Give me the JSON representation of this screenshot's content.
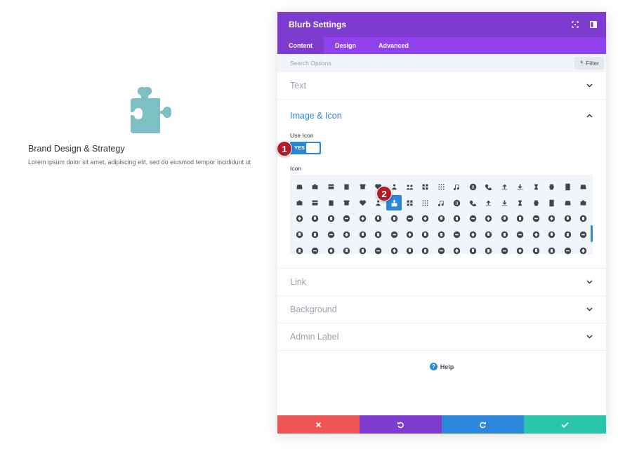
{
  "preview": {
    "icon": "puzzle-piece-icon",
    "icon_color": "#7ebec5",
    "title": "Brand Design & Strategy",
    "body": "Lorem ipsum dolor sit amet, adipiscing elit, sed do eiusmod tempor incididunt ut"
  },
  "modal": {
    "title": "Blurb Settings",
    "header_icons": [
      "fullscreen-icon",
      "sidebar-toggle-icon"
    ],
    "colors": {
      "header": "#7e3bd0",
      "tabs": "#8f42ec",
      "accent": "#2b87da"
    },
    "tabs": [
      {
        "label": "Content",
        "active": true
      },
      {
        "label": "Design",
        "active": false
      },
      {
        "label": "Advanced",
        "active": false
      }
    ],
    "search": {
      "placeholder": "Search Options",
      "filter_label": "Filter"
    },
    "sections": {
      "text": "Text",
      "image_icon": "Image & Icon",
      "link": "Link",
      "background": "Background",
      "admin_label": "Admin Label"
    },
    "use_icon": {
      "label": "Use Icon",
      "value": "YES"
    },
    "icon_field_label": "Icon",
    "help_label": "Help",
    "footer": {
      "buttons": [
        {
          "name": "discard",
          "icon": "close-icon",
          "color": "#ef5555"
        },
        {
          "name": "undo",
          "icon": "undo-icon",
          "color": "#7e3bd0"
        },
        {
          "name": "redo",
          "icon": "redo-icon",
          "color": "#2b87da"
        },
        {
          "name": "save",
          "icon": "check-icon",
          "color": "#29c4a9"
        }
      ]
    }
  },
  "annotations": [
    "1",
    "2"
  ]
}
